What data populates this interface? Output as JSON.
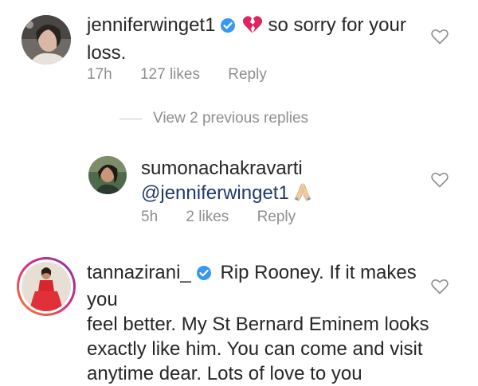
{
  "comments": [
    {
      "username": "jenniferwinget1",
      "verified": true,
      "emoji": "broken-heart-icon",
      "text_line1": "so sorry for your",
      "text_line2": "loss.",
      "time": "17h",
      "likes": "127 likes",
      "reply": "Reply"
    },
    {
      "username": "sumonachakravarti",
      "mention": "@jenniferwinget1",
      "emoji": "folded-hands-icon",
      "time": "5h",
      "likes": "2 likes",
      "reply": "Reply"
    },
    {
      "username": "tannazirani_",
      "verified": true,
      "has_story_ring": true,
      "text_line1": "Rip Rooney. If it makes you",
      "text_line2": "feel better. My St Bernard Eminem looks",
      "text_line3": "exactly like him. You can come and visit",
      "text_line4": "anytime dear. Lots of love to you"
    }
  ],
  "view_previous_replies": "View 2 previous replies",
  "colors": {
    "text": "#262626",
    "meta": "#8e8e8e",
    "verified": "#3897f0",
    "mention": "#1e3a6a",
    "story_ring_start": "#f58529",
    "story_ring_end": "#dd2a7b"
  }
}
